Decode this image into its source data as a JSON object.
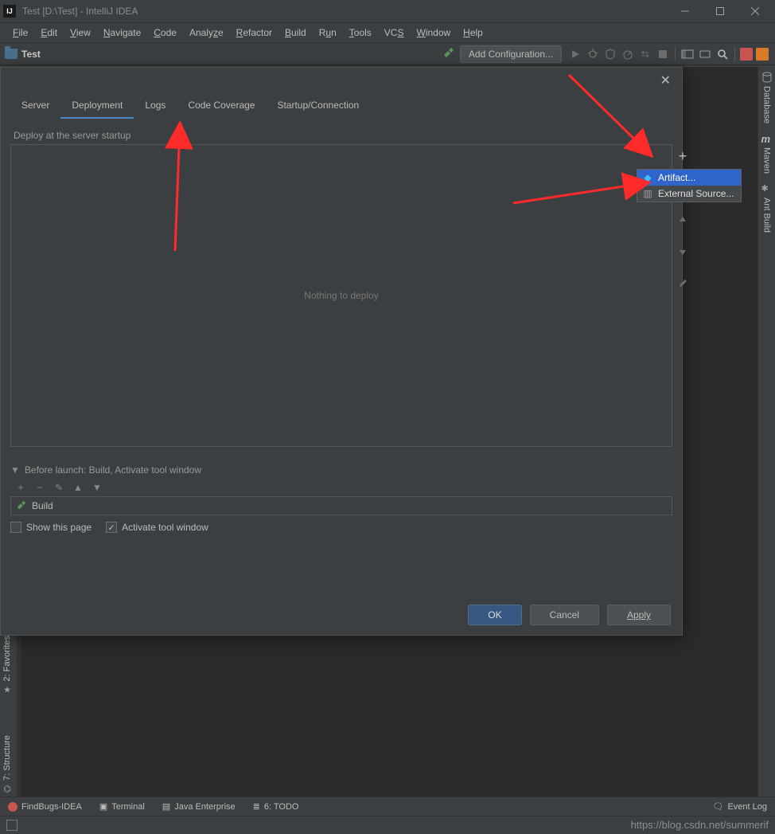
{
  "title": "Test [D:\\Test] - IntelliJ IDEA",
  "menu": [
    "File",
    "Edit",
    "View",
    "Navigate",
    "Code",
    "Analyze",
    "Refactor",
    "Build",
    "Run",
    "Tools",
    "VCS",
    "Window",
    "Help"
  ],
  "toolbar": {
    "project": "Test",
    "add_config": "Add Configuration..."
  },
  "right_tools": {
    "database": "Database",
    "maven": "Maven",
    "ant": "Ant Build"
  },
  "left_tools": {
    "favorites": "2: Favorites",
    "structure": "7: Structure"
  },
  "dialog": {
    "tabs": [
      "Server",
      "Deployment",
      "Logs",
      "Code Coverage",
      "Startup/Connection"
    ],
    "active_tab": 1,
    "deploy_label": "Deploy at the server startup",
    "empty_text": "Nothing to deploy",
    "popup": {
      "artifact": "Artifact...",
      "external": "External Source..."
    },
    "before_launch": "Before launch: Build, Activate tool window",
    "build_item": "Build",
    "chk_show": "Show this page",
    "chk_activate": "Activate tool window",
    "ok": "OK",
    "cancel": "Cancel",
    "apply": "Apply"
  },
  "bottom": {
    "findbugs": "FindBugs-IDEA",
    "terminal": "Terminal",
    "javaee": "Java Enterprise",
    "todo": "6: TODO",
    "eventlog": "Event Log"
  },
  "watermark": "https://blog.csdn.net/summerif"
}
